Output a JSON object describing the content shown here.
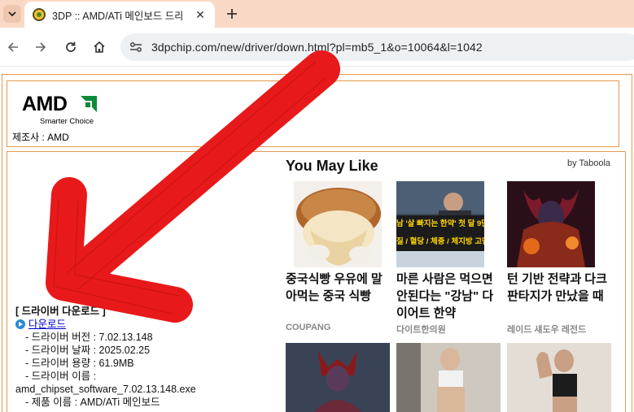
{
  "browser": {
    "tab_title": "3DP :: AMD/ATi 메인보드 드라",
    "url": "3dpchip.com/new/driver/down.html?pl=mb5_1&o=10064&l=1042"
  },
  "maker": {
    "logo_text": "AMD",
    "logo_sub": "Smarter Choice",
    "label": "제조사 : AMD"
  },
  "driver": {
    "heading": "[ 드라이버 다운로드 ]",
    "download_link": "다운로드",
    "version": "- 드라이버 버전 : 7.02.13.148",
    "date": "- 드라이버 날짜 : 2025.02.25",
    "size": "- 드라이버 용량 : 61.9MB",
    "name_label": "- 드라이버 이름 :",
    "filename": "amd_chipset_software_7.02.13.148.exe",
    "product": "- 제품 이름 : AMD/ATi 메인보드"
  },
  "taboola": {
    "title": "You May Like",
    "by": "by Taboola",
    "cards": [
      {
        "title": "중국식빵 우유에 말아먹는 중국 식빵",
        "source": "COUPANG"
      },
      {
        "title": "마른 사람은 먹으면 안된다는 \"강남\" 다이어트 한약",
        "source": "다이트한의원"
      },
      {
        "title": "턴 기반 전략과 다크 판타지가 만났을 때",
        "source": "레이드 섀도우 레전드"
      }
    ],
    "thumb_text_1": "남 '살 빠지는 한약' 첫 달 9만",
    "thumb_text_2": "질 / 혈당 / 체중 / 체지방 고민"
  },
  "colors": {
    "tab_strip": "#f9d9c6",
    "frame_border": "#e59a4a",
    "annotation_arrow": "#e8191a",
    "link": "#0000cc"
  }
}
